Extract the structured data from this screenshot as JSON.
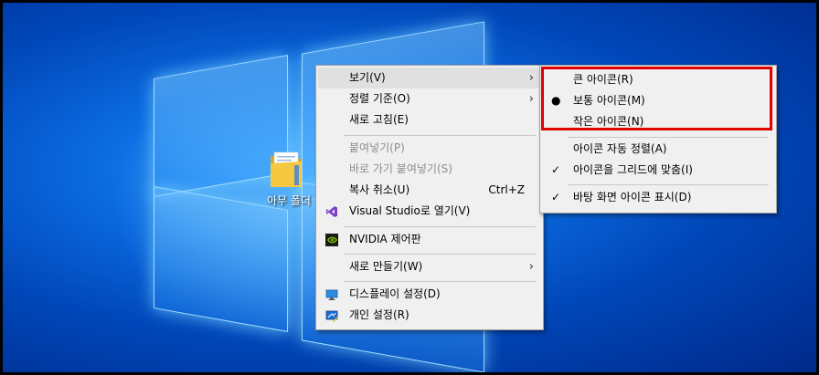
{
  "desktop": {
    "folder_label": "아무 폴더"
  },
  "main_menu": {
    "items": [
      {
        "label": "보기(V)",
        "has_submenu": true
      },
      {
        "label": "정렬 기준(O)",
        "has_submenu": true
      },
      {
        "label": "새로 고침(E)"
      },
      {
        "label": "붙여넣기(P)",
        "disabled": true
      },
      {
        "label": "바로 가기 붙여넣기(S)",
        "disabled": true
      },
      {
        "label": "복사 취소(U)",
        "shortcut": "Ctrl+Z"
      },
      {
        "label": "Visual Studio로 열기(V)",
        "icon": "visual-studio-icon"
      },
      {
        "label": "NVIDIA 제어판",
        "icon": "nvidia-icon"
      },
      {
        "label": "새로 만들기(W)",
        "has_submenu": true
      },
      {
        "label": "디스플레이 설정(D)",
        "icon": "display-settings-icon"
      },
      {
        "label": "개인 설정(R)",
        "icon": "personalize-icon"
      }
    ]
  },
  "view_submenu": {
    "items": [
      {
        "label": "큰 아이콘(R)"
      },
      {
        "label": "보통 아이콘(M)",
        "selected": true
      },
      {
        "label": "작은 아이콘(N)"
      },
      {
        "label": "아이콘 자동 정렬(A)"
      },
      {
        "label": "아이콘을 그리드에 맞춤(I)",
        "checked": true
      },
      {
        "label": "바탕 화면 아이콘 표시(D)",
        "checked": true
      }
    ]
  },
  "colors": {
    "highlight_box": "#e00000",
    "menu_bg": "#f0f0f0",
    "desktop_blue": "#0b6be0"
  }
}
